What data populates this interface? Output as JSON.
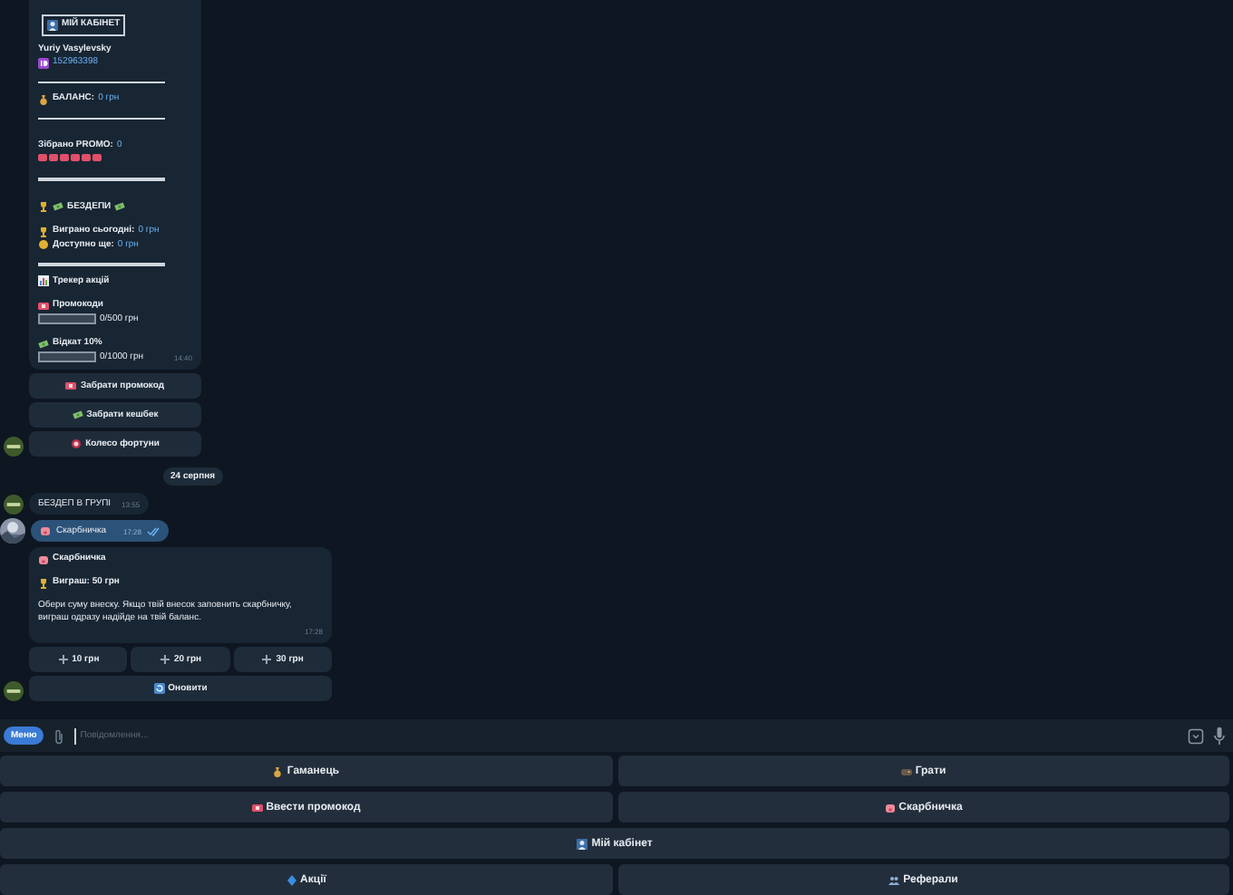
{
  "chat": {
    "profile_message": {
      "title": "МІЙ КАБІНЕТ",
      "name": "Yuriy Vasylevsky",
      "user_id": "152963398",
      "balance": {
        "label": "БАЛАНС:",
        "value": "0 грн"
      },
      "promo": {
        "label": "Зібрано PROMO:",
        "value": "0"
      },
      "bonus_heading": "БЕЗДЕПИ",
      "won_today": {
        "label": "Виграно сьогодні:",
        "value": "0 грн"
      },
      "available": {
        "label": "Доступно ще:",
        "value": "0 грн"
      },
      "tracker_heading": "Трекер акцій",
      "progress": [
        {
          "label": "Промокоди",
          "level": 0,
          "reading": "0/500 грн"
        },
        {
          "label": "Відкат 10%",
          "level": 0,
          "reading": "0/1000 грн"
        }
      ],
      "time": "14:40",
      "buttons": [
        "Забрати промокод",
        "Забрати кешбек",
        "Колесо фортуни"
      ]
    },
    "date": "24 серпня",
    "group_message": {
      "text": "БЕЗДЕП В ГРУПІ",
      "time": "13:55"
    },
    "sent_message": {
      "text": "Скарбничка",
      "time": "17:28",
      "read": true
    },
    "piggy_message": {
      "title": "Скарбничка",
      "prize": "Виграш: 50 грн",
      "body": "Обери суму внеску. Якщо твій внесок заповнить скарбничку, виграш одразу надійде на твій баланс.",
      "time": "17:28",
      "amounts": [
        "10 грн",
        "20 грн",
        "30 грн"
      ],
      "refresh": "Оновити"
    }
  },
  "composer": {
    "menu": "Меню",
    "placeholder": "Повідомлення..."
  },
  "keyboard": [
    [
      "Гаманець",
      "Грати"
    ],
    [
      "Ввести промокод",
      "Скарбничка"
    ],
    [
      "Мій кабінет"
    ],
    [
      "Акції",
      "Реферали"
    ]
  ]
}
